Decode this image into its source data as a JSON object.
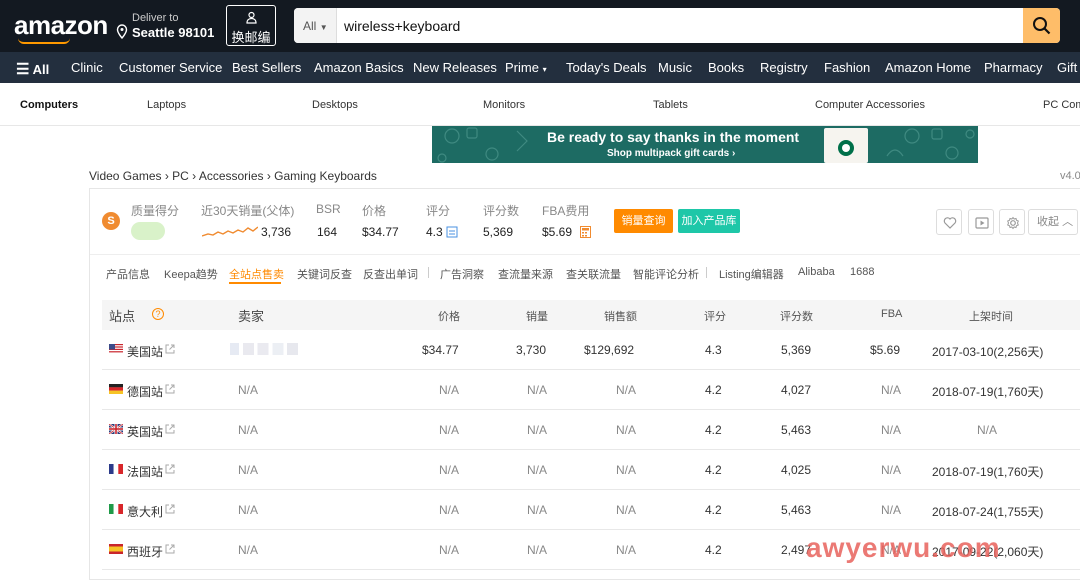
{
  "header": {
    "logo": "amazon",
    "deliver_line1": "Deliver to",
    "deliver_line2": "Seattle 98101",
    "zip_button": "换邮编",
    "search_category": "All",
    "search_value": "wireless+keyboard"
  },
  "nav": {
    "all": "All",
    "items": [
      "Clinic",
      "Customer Service",
      "Best Sellers",
      "Amazon Basics",
      "New Releases",
      "Prime",
      "Today's Deals",
      "Music",
      "Books",
      "Registry",
      "Fashion",
      "Amazon Home",
      "Pharmacy",
      "Gift"
    ]
  },
  "categories": [
    "Computers",
    "Laptops",
    "Desktops",
    "Monitors",
    "Tablets",
    "Computer Accessories",
    "PC Comp"
  ],
  "banner": {
    "line1": "Be ready to say thanks in the moment",
    "line2": "Shop multipack gift cards ›"
  },
  "breadcrumb": "Video Games › PC › Accessories › Gaming Keyboards",
  "version": "v4.0",
  "metrics": {
    "quality_label": "质量得分",
    "sales30_label": "近30天销量(父体)",
    "sales30_value": "3,736",
    "bsr_label": "BSR",
    "bsr_value": "164",
    "price_label": "价格",
    "price_value": "$34.77",
    "rating_label": "评分",
    "rating_value": "4.3",
    "reviews_label": "评分数",
    "reviews_value": "5,369",
    "fba_label": "FBA费用",
    "fba_value": "$5.69",
    "btn_sales": "销量查询",
    "btn_add": "加入产品库",
    "collapse": "收起"
  },
  "tabs": [
    "产品信息",
    "Keepa趋势",
    "全站点售卖",
    "关键词反查",
    "反查出单词",
    "广告洞察",
    "查流量来源",
    "查关联流量",
    "智能评论分析",
    "Listing编辑器",
    "Alibaba",
    "1688"
  ],
  "table": {
    "headers": {
      "site": "站点",
      "seller": "卖家",
      "price": "价格",
      "sales": "销量",
      "revenue": "销售额",
      "rating": "评分",
      "reviews": "评分数",
      "fba": "FBA",
      "launch": "上架时间"
    },
    "rows": [
      {
        "site": "美国站",
        "seller": "",
        "price": "$34.77",
        "sales": "3,730",
        "revenue": "$129,692",
        "rating": "4.3",
        "reviews": "5,369",
        "fba": "$5.69",
        "launch": "2017-03-10(2,256天)"
      },
      {
        "site": "德国站",
        "seller": "N/A",
        "price": "N/A",
        "sales": "N/A",
        "revenue": "N/A",
        "rating": "4.2",
        "reviews": "4,027",
        "fba": "N/A",
        "launch": "2018-07-19(1,760天)"
      },
      {
        "site": "英国站",
        "seller": "N/A",
        "price": "N/A",
        "sales": "N/A",
        "revenue": "N/A",
        "rating": "4.2",
        "reviews": "5,463",
        "fba": "N/A",
        "launch": "N/A"
      },
      {
        "site": "法国站",
        "seller": "N/A",
        "price": "N/A",
        "sales": "N/A",
        "revenue": "N/A",
        "rating": "4.2",
        "reviews": "4,025",
        "fba": "N/A",
        "launch": "2018-07-19(1,760天)"
      },
      {
        "site": "意大利",
        "seller": "N/A",
        "price": "N/A",
        "sales": "N/A",
        "revenue": "N/A",
        "rating": "4.2",
        "reviews": "5,463",
        "fba": "N/A",
        "launch": "2018-07-24(1,755天)"
      },
      {
        "site": "西班牙",
        "seller": "N/A",
        "price": "N/A",
        "sales": "N/A",
        "revenue": "N/A",
        "rating": "4.2",
        "reviews": "2,497",
        "fba": "N/A",
        "launch": "2017-09-22(2,060天)"
      }
    ]
  },
  "watermark": "awyerwu.com",
  "colors": {
    "amazon_dark": "#131921",
    "amazon_nav": "#232f3e",
    "search_button": "#febd69",
    "accent_orange": "#ff8a00",
    "accent_teal": "#1ec7a8"
  }
}
